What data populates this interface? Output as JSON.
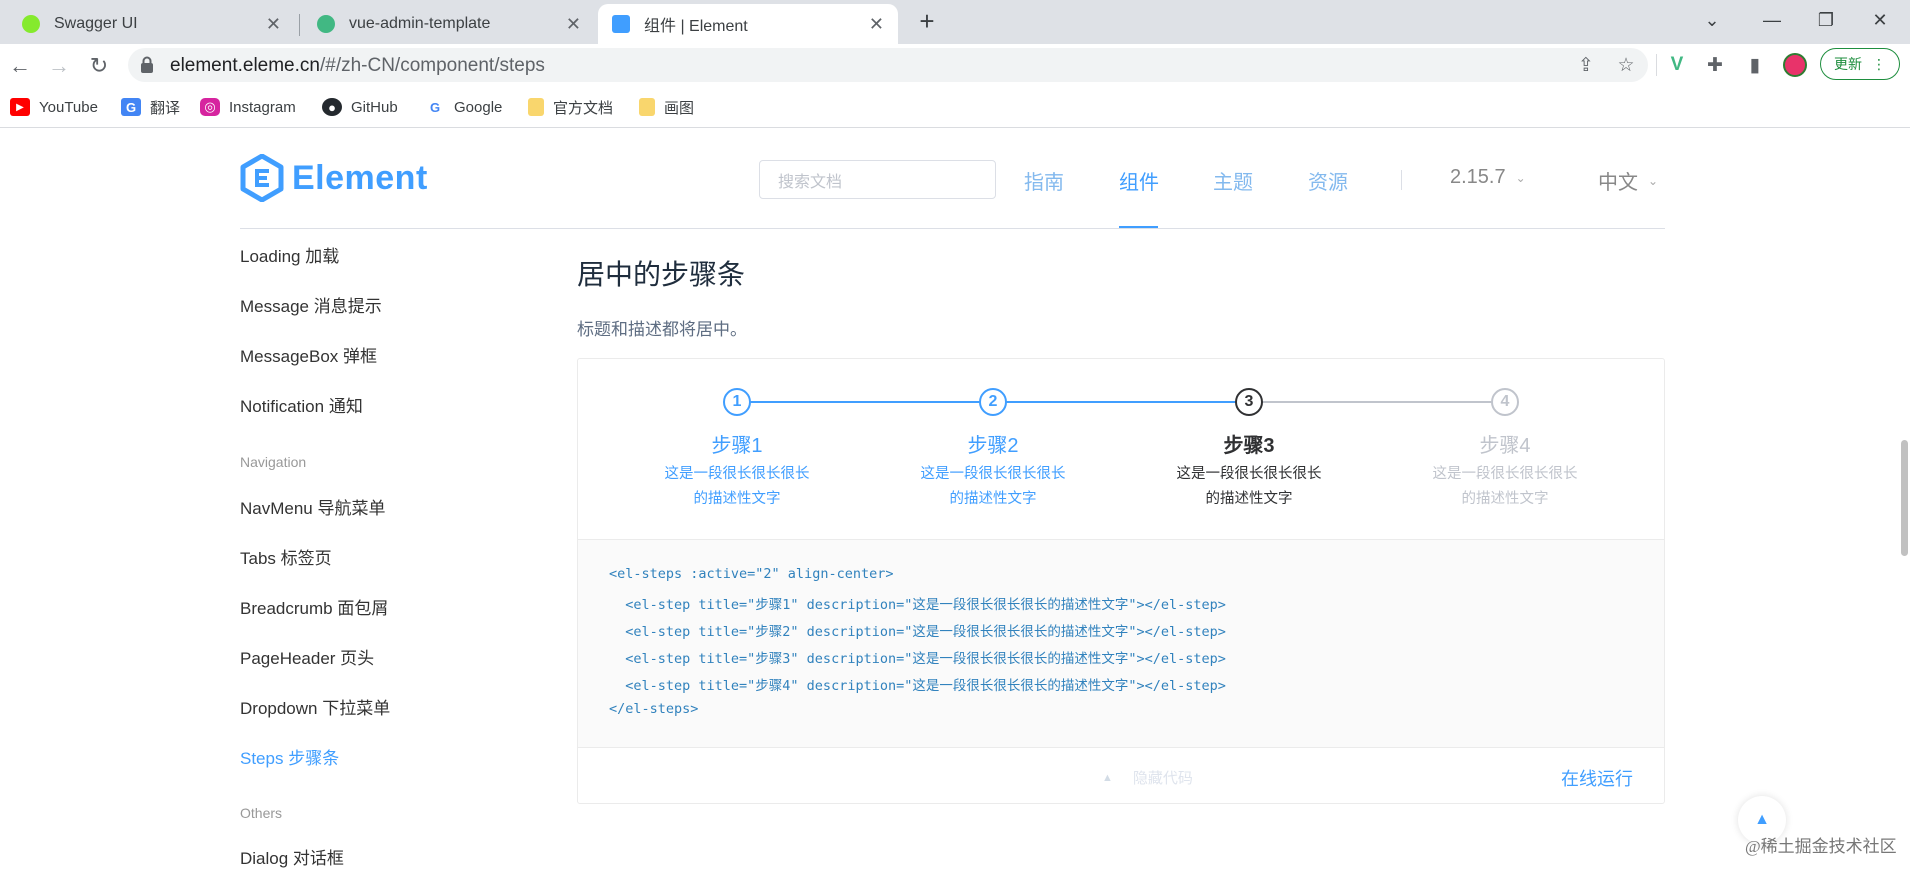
{
  "browser": {
    "tabs": [
      {
        "title": "Swagger UI",
        "favicon_color": "#85ea2d"
      },
      {
        "title": "vue-admin-template",
        "favicon_color": "#41b883"
      },
      {
        "title": "组件 | Element",
        "favicon_color": "#409eff",
        "active": true
      }
    ],
    "new_tab_icon": "+",
    "url_host": "element.eleme.cn",
    "url_path": "/#/zh-CN/component/steps",
    "update_label": "更新",
    "bookmarks": [
      {
        "label": "YouTube",
        "icon": "youtube-icon"
      },
      {
        "label": "翻译",
        "icon": "translate-icon"
      },
      {
        "label": "Instagram",
        "icon": "instagram-icon"
      },
      {
        "label": "GitHub",
        "icon": "github-icon"
      },
      {
        "label": "Google",
        "icon": "google-icon"
      },
      {
        "label": "官方文档",
        "icon": "folder-icon"
      },
      {
        "label": "画图",
        "icon": "folder-icon"
      }
    ]
  },
  "header": {
    "logo_text": "Element",
    "search_placeholder": "搜索文档",
    "nav": [
      "指南",
      "组件",
      "主题",
      "资源"
    ],
    "active_nav": "组件",
    "version": "2.15.7",
    "language": "中文"
  },
  "sidebar": {
    "items_top": [
      "Loading 加载",
      "Message 消息提示",
      "MessageBox 弹框",
      "Notification 通知"
    ],
    "group_navigation": "Navigation",
    "items_nav": [
      "NavMenu 导航菜单",
      "Tabs 标签页",
      "Breadcrumb 面包屑",
      "PageHeader 页头",
      "Dropdown 下拉菜单",
      "Steps 步骤条"
    ],
    "active_item": "Steps 步骤条",
    "group_others": "Others",
    "items_others": [
      "Dialog 对话框"
    ]
  },
  "content": {
    "section_title": "居中的步骤条",
    "section_desc": "标题和描述都将居中。",
    "steps": [
      {
        "num": "1",
        "title": "步骤1",
        "desc1": "这是一段很长很长很长",
        "desc2": "的描述性文字",
        "status": "finish"
      },
      {
        "num": "2",
        "title": "步骤2",
        "desc1": "这是一段很长很长很长",
        "desc2": "的描述性文字",
        "status": "finish"
      },
      {
        "num": "3",
        "title": "步骤3",
        "desc1": "这是一段很长很长很长",
        "desc2": "的描述性文字",
        "status": "process"
      },
      {
        "num": "4",
        "title": "步骤4",
        "desc1": "这是一段很长很长很长",
        "desc2": "的描述性文字",
        "status": "wait"
      }
    ],
    "code_lines": [
      "<el-steps :active=\"2\" align-center>",
      "  <el-step title=\"步骤1\" description=\"这是一段很长很长很长的描述性文字\"></el-step>",
      "  <el-step title=\"步骤2\" description=\"这是一段很长很长很长的描述性文字\"></el-step>",
      "  <el-step title=\"步骤3\" description=\"这是一段很长很长很长的描述性文字\"></el-step>",
      "  <el-step title=\"步骤4\" description=\"这是一段很长很长很长的描述性文字\"></el-step>",
      "</el-steps>"
    ],
    "hide_code_label": "隐藏代码",
    "run_online_label": "在线运行"
  },
  "watermark": "@稀土掘金技术社区",
  "colors": {
    "primary": "#409eff",
    "finish": "#409eff",
    "process": "#303133",
    "wait": "#c0c4cc"
  }
}
